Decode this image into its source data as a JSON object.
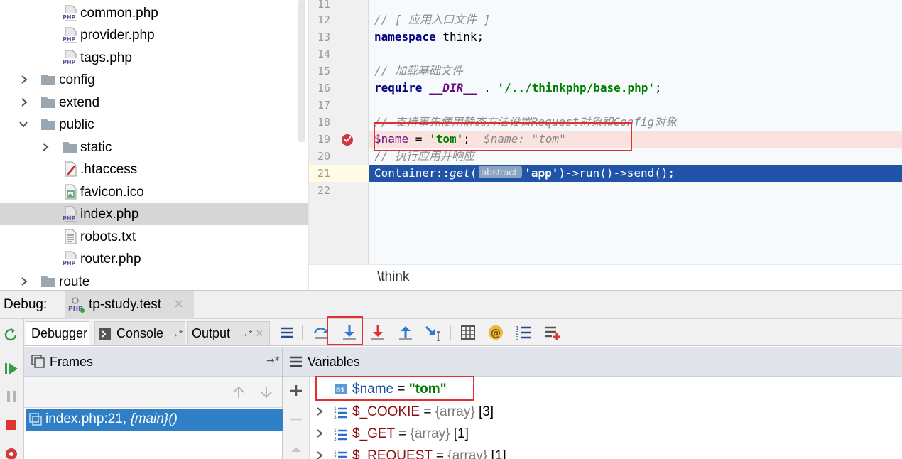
{
  "project_tree": {
    "items": [
      {
        "label": "common.php",
        "type": "php"
      },
      {
        "label": "provider.php",
        "type": "php"
      },
      {
        "label": "tags.php",
        "type": "php"
      },
      {
        "label": "config",
        "type": "folder",
        "expanded": false
      },
      {
        "label": "extend",
        "type": "folder",
        "expanded": false
      },
      {
        "label": "public",
        "type": "folder",
        "expanded": true
      },
      {
        "label": "static",
        "type": "folder",
        "expanded": false
      },
      {
        "label": ".htaccess",
        "type": "htaccess"
      },
      {
        "label": "favicon.ico",
        "type": "image"
      },
      {
        "label": "index.php",
        "type": "php",
        "selected": true
      },
      {
        "label": "robots.txt",
        "type": "text"
      },
      {
        "label": "router.php",
        "type": "php"
      },
      {
        "label": "route",
        "type": "folder",
        "expanded": false
      }
    ]
  },
  "editor": {
    "lines": [
      {
        "num": "11"
      },
      {
        "num": "12",
        "comment": "// [ 应用入口文件 ]"
      },
      {
        "num": "13",
        "keyword": "namespace",
        "rest": " think;"
      },
      {
        "num": "14"
      },
      {
        "num": "15",
        "comment": "// 加载基础文件"
      },
      {
        "num": "16",
        "keyword": "require",
        "magic": "__DIR__",
        "op": " . ",
        "string": "'/../thinkphp/base.php'",
        "end": ";"
      },
      {
        "num": "17"
      },
      {
        "num": "18",
        "comment": "// 支持事先使用静态方法设置Request对象和Config对象"
      },
      {
        "num": "19",
        "var": "$name",
        "op": " = ",
        "string": "'tom'",
        "end": ";",
        "inline_value": "$name: \"tom\""
      },
      {
        "num": "20",
        "comment": "// 执行应用并响应"
      },
      {
        "num": "21",
        "class": "Container",
        "sep": "::",
        "method": "get",
        "open": "(",
        "hint": "abstract:",
        "string": "'app'",
        "rest": ")->run()->send();"
      },
      {
        "num": "22"
      }
    ],
    "breadcrumb": "\\think"
  },
  "debug": {
    "label": "Debug:",
    "session": "tp-study.test",
    "session_close": "×",
    "tabs": [
      {
        "label": "Debugger",
        "active": true
      },
      {
        "label": "Console",
        "pin": "→*"
      },
      {
        "label": "Output",
        "pin": "→*",
        "close": "×"
      }
    ],
    "frames": {
      "title": "Frames",
      "pin": "→*",
      "selected_frame_location": "index.php:21,",
      "selected_frame_function": "{main}()"
    },
    "variables": {
      "title": "Variables",
      "items": [
        {
          "name": "$name",
          "eq": " = ",
          "value": "\"tom\"",
          "kind": "string"
        },
        {
          "name": "$_COOKIE",
          "eq": " = ",
          "type": "{array}",
          "count": " [3]",
          "kind": "array"
        },
        {
          "name": "$_GET",
          "eq": " = ",
          "type": "{array}",
          "count": " [1]",
          "kind": "array"
        },
        {
          "name": "$_REQUEST",
          "eq": " = ",
          "type": "{array}",
          "count": " [1]",
          "kind": "array"
        }
      ]
    }
  },
  "colors": {
    "selection_blue": "#2154a9",
    "frame_selection": "#2f7fc6",
    "breakpoint_red": "#d2383d",
    "highlight_box_red": "#e03030",
    "comment_gray": "#8c8c8c",
    "keyword_navy": "#000080",
    "string_green": "#008000"
  },
  "icons": {
    "php_file": "php-file-icon",
    "folder": "folder-icon",
    "breakpoint": "breakpoint-icon",
    "step_into": "step-into-icon"
  }
}
